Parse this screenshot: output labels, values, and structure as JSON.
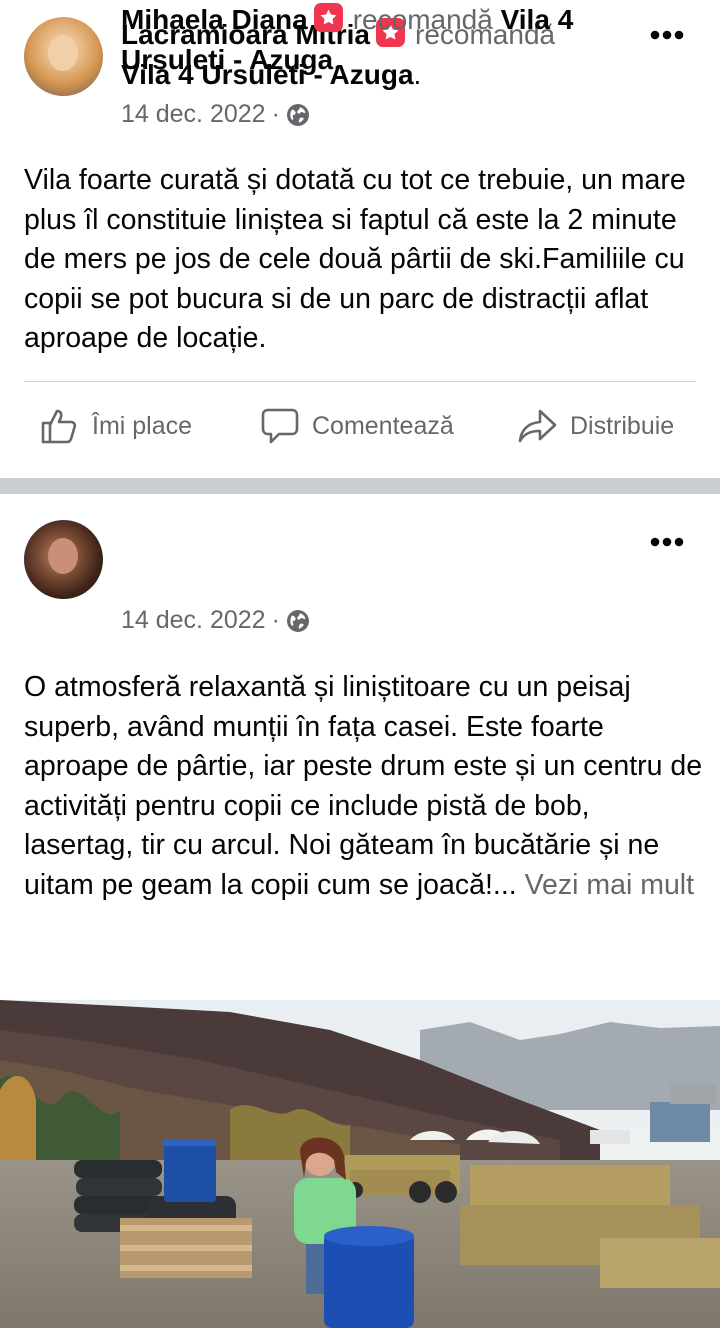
{
  "posts": [
    {
      "author": "Lacramioara Mitria",
      "recommend_word": "recomandă",
      "page_name": "Vila 4 Ursuleti - Azuga",
      "date": "14 dec. 2022",
      "meta_separator": "·",
      "body": "Vila foarte curată și dotată cu tot ce trebuie, un mare plus îl constituie liniștea si faptul că este la 2 minute de mers pe jos de cele două pârtii de ski.Familiile cu copii se pot bucura si de un parc de distracții aflat aproape de locație.",
      "actions": {
        "like": "Îmi place",
        "comment": "Comentează",
        "share": "Distribuie"
      }
    },
    {
      "author": "Mihaela Diana",
      "recommend_word": "recomandă",
      "page_name": "Vila 4 Ursuleti - Azuga",
      "date": "14 dec. 2022",
      "meta_separator": "·",
      "body": "O atmosferă relaxantă și liniștitoare cu un peisaj superb, având munții în fața casei. Este foarte aproape de pârtie, iar peste drum este și un centru de activități pentru copii ce include pistă de bob, lasertag, tir cu arcul. Noi găteam în bucătărie și ne uitam pe geam la copii cum se joacă!...",
      "see_more": "Vezi mai mult"
    }
  ],
  "colors": {
    "secondary_text": "#65676b",
    "recommend_badge": "#f0354f",
    "separator": "#c9ccd1"
  },
  "icons": [
    "recommend-icon",
    "globe-icon",
    "more-options-icon",
    "like-icon",
    "comment-icon",
    "share-icon"
  ]
}
